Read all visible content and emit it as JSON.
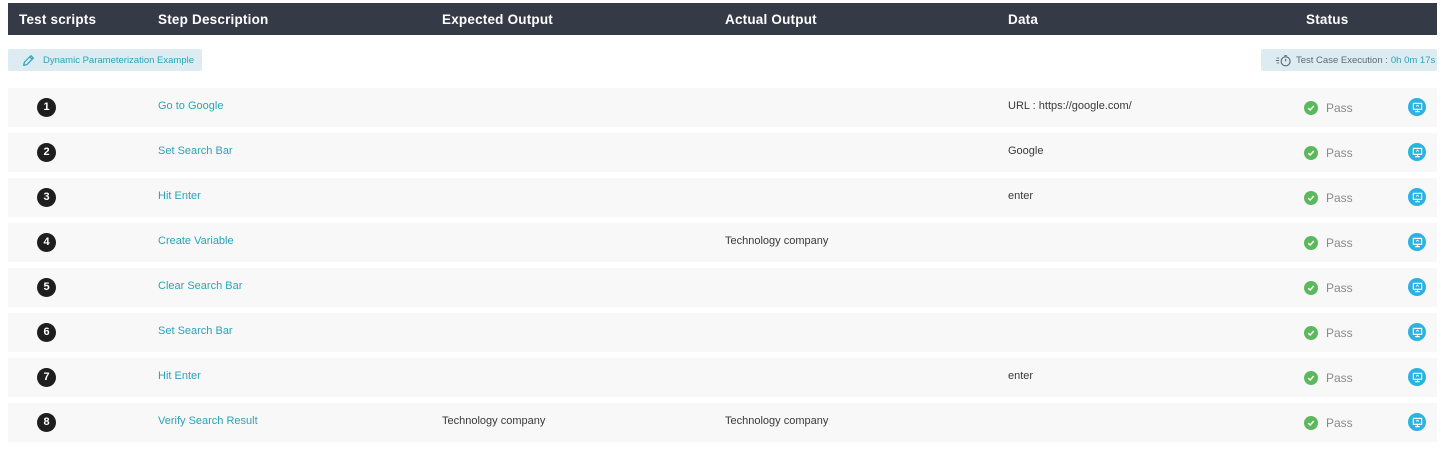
{
  "header": {
    "test_scripts": "Test scripts",
    "step_description": "Step Description",
    "expected_output": "Expected Output",
    "actual_output": "Actual Output",
    "data": "Data",
    "status": "Status"
  },
  "test_case_name": "Dynamic Parameterization Example",
  "execution": {
    "label": "Test Case Execution :",
    "time": "0h 0m 17s"
  },
  "colors": {
    "header_bg": "#343b46",
    "accent": "#2aa3b8",
    "pass_green": "#5cb85c",
    "screenshot_blue": "#2bb3e0"
  },
  "steps": [
    {
      "num": "1",
      "description": "Go to Google",
      "expected": "",
      "actual": "",
      "data": "URL : https://google.com/",
      "status": "Pass"
    },
    {
      "num": "2",
      "description": "Set Search Bar",
      "expected": "",
      "actual": "",
      "data": "Google",
      "status": "Pass"
    },
    {
      "num": "3",
      "description": "Hit Enter",
      "expected": "",
      "actual": "",
      "data": "enter",
      "status": "Pass"
    },
    {
      "num": "4",
      "description": "Create Variable",
      "expected": "",
      "actual": "Technology company",
      "data": "",
      "status": "Pass"
    },
    {
      "num": "5",
      "description": "Clear Search Bar",
      "expected": "",
      "actual": "",
      "data": "",
      "status": "Pass"
    },
    {
      "num": "6",
      "description": "Set Search Bar",
      "expected": "",
      "actual": "",
      "data": "",
      "status": "Pass"
    },
    {
      "num": "7",
      "description": "Hit Enter",
      "expected": "",
      "actual": "",
      "data": "enter",
      "status": "Pass"
    },
    {
      "num": "8",
      "description": "Verify Search Result",
      "expected": "Technology company",
      "actual": "Technology company",
      "data": "",
      "status": "Pass"
    }
  ]
}
